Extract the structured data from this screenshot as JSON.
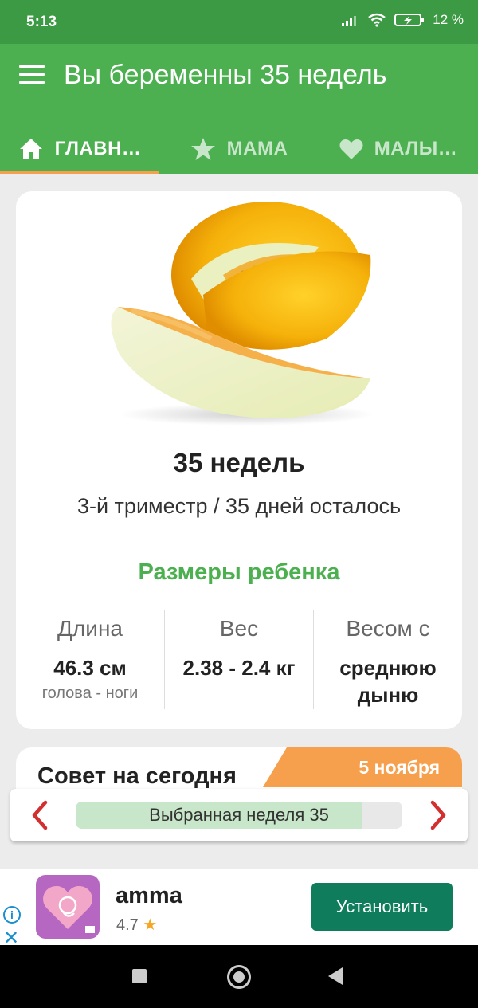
{
  "status_bar": {
    "time": "5:13",
    "battery": "12 %"
  },
  "app_bar": {
    "title": "Вы беременны 35 недель"
  },
  "tabs": [
    {
      "label": "ГЛАВН…",
      "icon": "home-icon",
      "active": true
    },
    {
      "label": "МАМА",
      "icon": "star-icon",
      "active": false
    },
    {
      "label": "МАЛЫ…",
      "icon": "heart-icon",
      "active": false
    }
  ],
  "week_card": {
    "image": "melon-image",
    "title": "35 недель",
    "subtitle": "3-й триместр / 35 дней осталось",
    "sizes_title": "Размеры ребенка",
    "stats": [
      {
        "label": "Длина",
        "value": "46.3 см",
        "note": "голова - ноги"
      },
      {
        "label": "Вес",
        "value": "2.38 - 2.4 кг"
      },
      {
        "label": "Весом с",
        "value": "среднюю дыню"
      }
    ]
  },
  "tip_card": {
    "title": "Совет на сегодня",
    "date": "5 ноября"
  },
  "week_selector": {
    "label": "Выбранная неделя 35",
    "progress": 0.875
  },
  "ad": {
    "name": "amma",
    "rating": "4.7",
    "install_label": "Установить",
    "logo_text": "am ma",
    "colors": {
      "button": "#0f7d5c"
    }
  },
  "theme": {
    "primary": "#4caf50",
    "status_bar": "#3d9a44",
    "accent": "#f6a04d"
  }
}
